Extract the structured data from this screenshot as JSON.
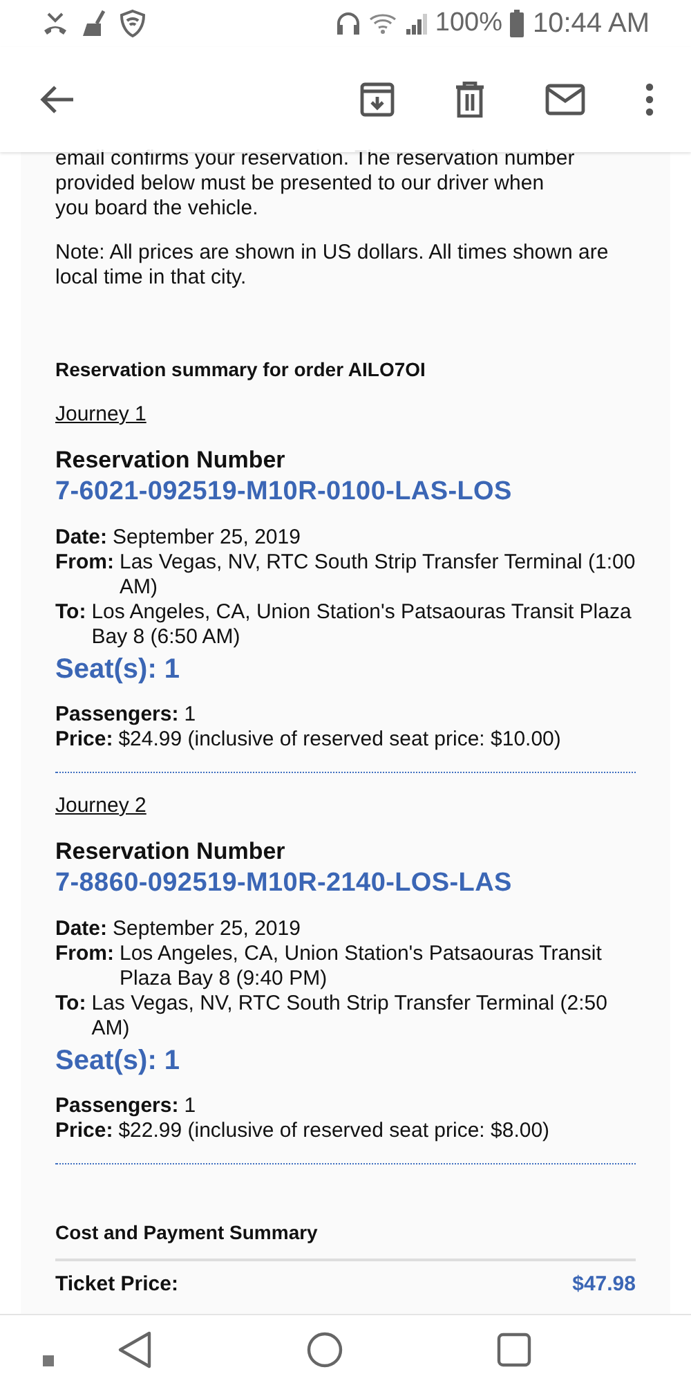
{
  "status_bar": {
    "battery": "100%",
    "time": "10:44 AM"
  },
  "email": {
    "intro": "email confirms your reservation. The reservation number provided below must be presented to our driver when you board the vehicle.",
    "note": "Note: All prices are shown in US dollars. All times shown are local time in that city.",
    "summary_title": "Reservation summary for order AILO7OI",
    "journeys": [
      {
        "title": "Journey 1",
        "number_label": "Reservation Number",
        "number": "7-6021-092519-M10R-0100-LAS-LOS",
        "fields": [
          {
            "label": "Date:",
            "value": "September 25, 2019"
          },
          {
            "label": "From:",
            "value": "Las Vegas, NV, RTC South Strip Transfer Terminal (1:00 AM)"
          },
          {
            "label": "To:",
            "value": "Los Angeles, CA, Union Station's Patsaouras Transit Plaza Bay 8 (6:50 AM)"
          }
        ],
        "seats": "Seat(s): 1",
        "fields2": [
          {
            "label": "Passengers:",
            "value": "1"
          },
          {
            "label": "Price:",
            "value": "$24.99 (inclusive of reserved seat price: $10.00)"
          }
        ]
      },
      {
        "title": "Journey 2",
        "number_label": "Reservation Number",
        "number": "7-8860-092519-M10R-2140-LOS-LAS",
        "fields": [
          {
            "label": "Date:",
            "value": "September 25, 2019"
          },
          {
            "label": "From:",
            "value": "Los Angeles, CA, Union Station's Patsaouras Transit Plaza Bay 8 (9:40 PM)"
          },
          {
            "label": "To:",
            "value": "Las Vegas, NV, RTC South Strip Transfer Terminal (2:50 AM)"
          }
        ],
        "seats": "Seat(s): 1",
        "fields2": [
          {
            "label": "Passengers:",
            "value": "1"
          },
          {
            "label": "Price:",
            "value": "$22.99 (inclusive of reserved seat price: $8.00)"
          }
        ]
      }
    ],
    "cost_title": "Cost and Payment Summary",
    "costs": [
      {
        "label": "Ticket Price:",
        "value": "$47.98"
      }
    ]
  }
}
